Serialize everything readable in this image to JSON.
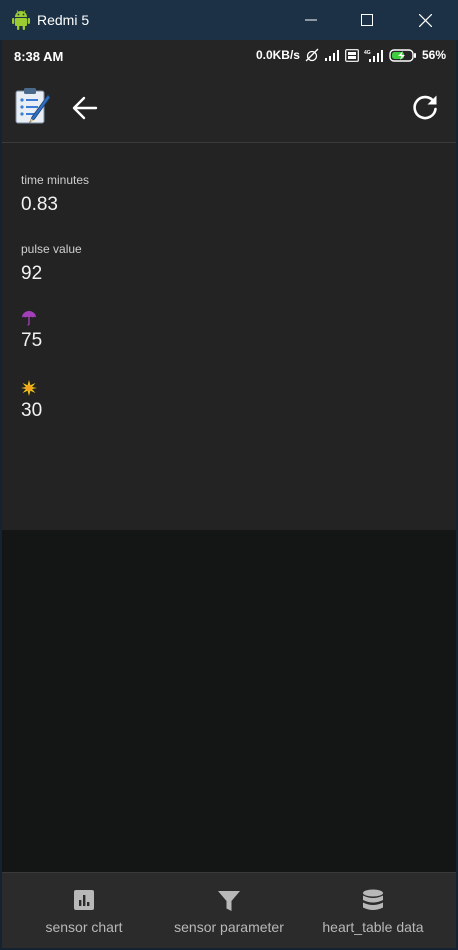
{
  "window": {
    "title": "Redmi 5",
    "icons": {
      "app": "android-icon",
      "minimize": "minimize-icon",
      "maximize": "maximize-icon",
      "close": "close-icon"
    }
  },
  "status_bar": {
    "time": "8:38 AM",
    "network_speed": "0.0KB/s",
    "battery": "56%"
  },
  "app_bar": {
    "icons": {
      "logo": "checklist-pencil-icon",
      "back": "arrow-left-icon",
      "refresh": "refresh-icon"
    }
  },
  "fields": [
    {
      "label": "time minutes",
      "value": "0.83"
    },
    {
      "label": "pulse value",
      "value": "92"
    },
    {
      "icon": "umbrella-icon",
      "value": "75"
    },
    {
      "icon": "sun-icon",
      "value": "30"
    }
  ],
  "bottom_nav": [
    {
      "label": "sensor chart",
      "icon": "bar-chart-icon"
    },
    {
      "label": "sensor parameter",
      "icon": "filter-icon"
    },
    {
      "label": "heart_table data",
      "icon": "database-icon"
    }
  ],
  "colors": {
    "titlebar": "#1c3146",
    "surface": "#232323",
    "background": "#131614",
    "bottom_nav": "#2b2b2b",
    "text_primary": "#f2f2f2",
    "text_secondary": "#b8b8b8",
    "umbrella": "#a23fb8",
    "sun": "#f0c419"
  }
}
